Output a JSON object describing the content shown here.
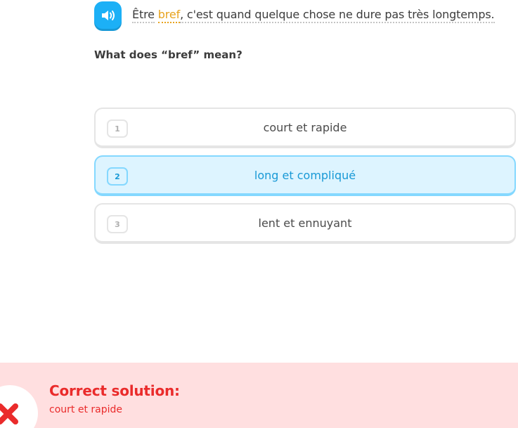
{
  "exercise": {
    "audio_icon": "speaker-icon",
    "sentence": {
      "part1": "Être",
      "keyword": "bref",
      "part2": ", c'est quand quelque chose ne dure pas très longtemps."
    },
    "question": "What does “bref” mean?"
  },
  "choices": [
    {
      "number": "1",
      "label": "court et rapide",
      "selected": false
    },
    {
      "number": "2",
      "label": "long et compliqué",
      "selected": true
    },
    {
      "number": "3",
      "label": "lent et ennuyant",
      "selected": false
    }
  ],
  "feedback": {
    "icon": "x-icon",
    "title": "Correct solution:",
    "answer": "court et rapide"
  },
  "colors": {
    "accent_blue": "#1cb0f6",
    "keyword_orange": "#e8a31e",
    "error_red": "#ea2b2b",
    "error_bg": "#ffdfe0",
    "selected_bg": "#ddf4ff"
  }
}
